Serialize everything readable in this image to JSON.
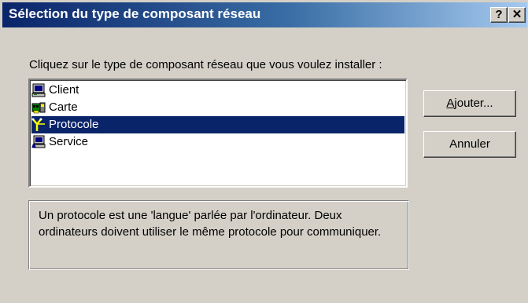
{
  "window": {
    "title": "Sélection du type de composant réseau",
    "help_label": "?",
    "close_label": "✕"
  },
  "instruction": "Cliquez sur le type de composant réseau que vous voulez installer :",
  "list": {
    "items": [
      {
        "label": "Client",
        "icon": "client-computer-icon",
        "selected": false
      },
      {
        "label": "Carte",
        "icon": "network-card-icon",
        "selected": false
      },
      {
        "label": "Protocole",
        "icon": "protocol-icon",
        "selected": true
      },
      {
        "label": "Service",
        "icon": "service-icon",
        "selected": false
      }
    ]
  },
  "buttons": {
    "add_underlined": "A",
    "add_rest": "jouter...",
    "cancel": "Annuler"
  },
  "description": "Un protocole est une 'langue' parlée par l'ordinateur. Deux ordinateurs doivent utiliser le même protocole pour communiquer.",
  "colors": {
    "face": "#d4d0c8",
    "title_start": "#0a246a",
    "title_end": "#a6caf0",
    "selection": "#0a246a"
  }
}
